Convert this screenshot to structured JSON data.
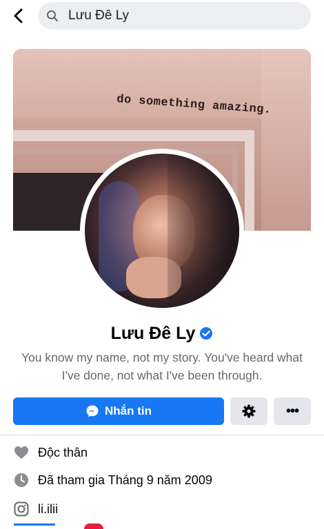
{
  "search": {
    "query": "Lưu Đê Ly"
  },
  "cover": {
    "quote": "do something amazing."
  },
  "profile": {
    "name": "Lưu Đê Ly",
    "bio": "You know my name, not my story. You've heard what I've done, not what I've been through."
  },
  "actions": {
    "message_label": "Nhắn tin"
  },
  "details": [
    {
      "icon": "heart-icon",
      "text": "Độc thân"
    },
    {
      "icon": "clock-icon",
      "text": "Đã tham gia Tháng 9 năm 2009"
    },
    {
      "icon": "instagram-icon",
      "text": "li.ilii"
    }
  ],
  "colors": {
    "accent": "#1877f2",
    "notification": "#e41e3f"
  }
}
